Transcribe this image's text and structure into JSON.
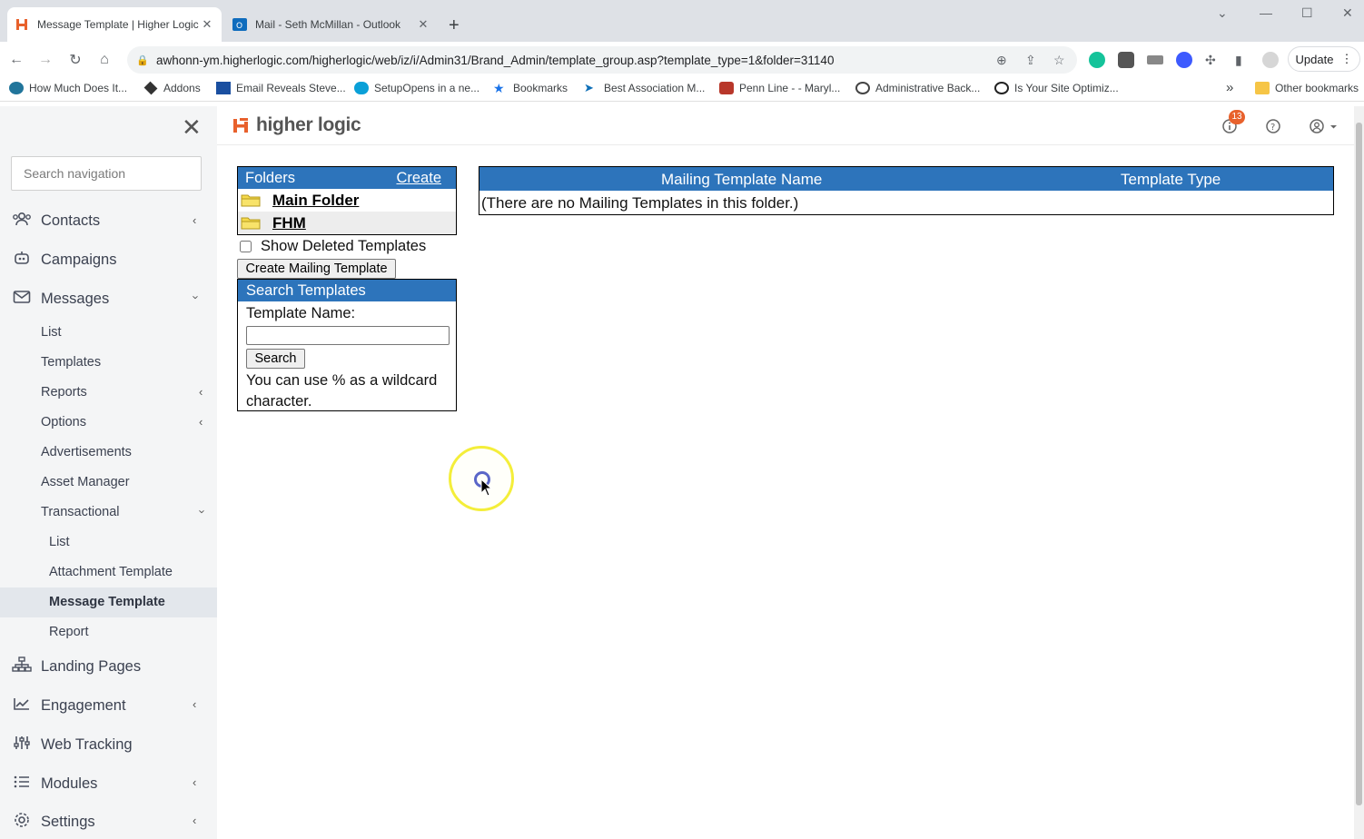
{
  "browser": {
    "tabs": [
      {
        "title": "Message Template | Higher Logic",
        "active": true
      },
      {
        "title": "Mail - Seth McMillan - Outlook",
        "active": false
      }
    ],
    "url": "awhonn-ym.higherlogic.com/higherlogic/web/iz/i/Admin31/Brand_Admin/template_group.asp?template_type=1&folder=31140",
    "update_label": "Update",
    "bookmarks": [
      "How Much Does It...",
      "Addons",
      "Email Reveals Steve...",
      "SetupOpens in a ne...",
      "Bookmarks",
      "Best Association M...",
      "Penn Line - - Maryl...",
      "Administrative Back...",
      "Is Your Site Optimiz..."
    ],
    "other_bookmarks": "Other bookmarks",
    "overflow": "»"
  },
  "app": {
    "logo_text": "higher logic",
    "notification_count": "13",
    "sidebar": {
      "search_placeholder": "Search navigation",
      "items": {
        "contacts": "Contacts",
        "campaigns": "Campaigns",
        "messages": "Messages",
        "landing_pages": "Landing Pages",
        "engagement": "Engagement",
        "web_tracking": "Web Tracking",
        "modules": "Modules",
        "settings": "Settings"
      },
      "messages_sub": {
        "list": "List",
        "templates": "Templates",
        "reports": "Reports",
        "options": "Options",
        "advertisements": "Advertisements",
        "asset_manager": "Asset Manager",
        "transactional": "Transactional"
      },
      "transactional_sub": {
        "list": "List",
        "attachment_template": "Attachment Template",
        "message_template": "Message Template",
        "report": "Report"
      }
    },
    "folders": {
      "header": "Folders",
      "create": "Create",
      "items": [
        "Main Folder",
        "FHM"
      ]
    },
    "show_deleted_label": "Show Deleted Templates",
    "create_button": "Create Mailing Template",
    "search": {
      "header": "Search Templates",
      "label": "Template Name:",
      "value": "",
      "button": "Search",
      "help": "You can use % as a wildcard character."
    },
    "table": {
      "columns": [
        "Mailing Template Name",
        "Template Type"
      ],
      "empty_message": "(There are no Mailing Templates in this folder.)"
    }
  }
}
